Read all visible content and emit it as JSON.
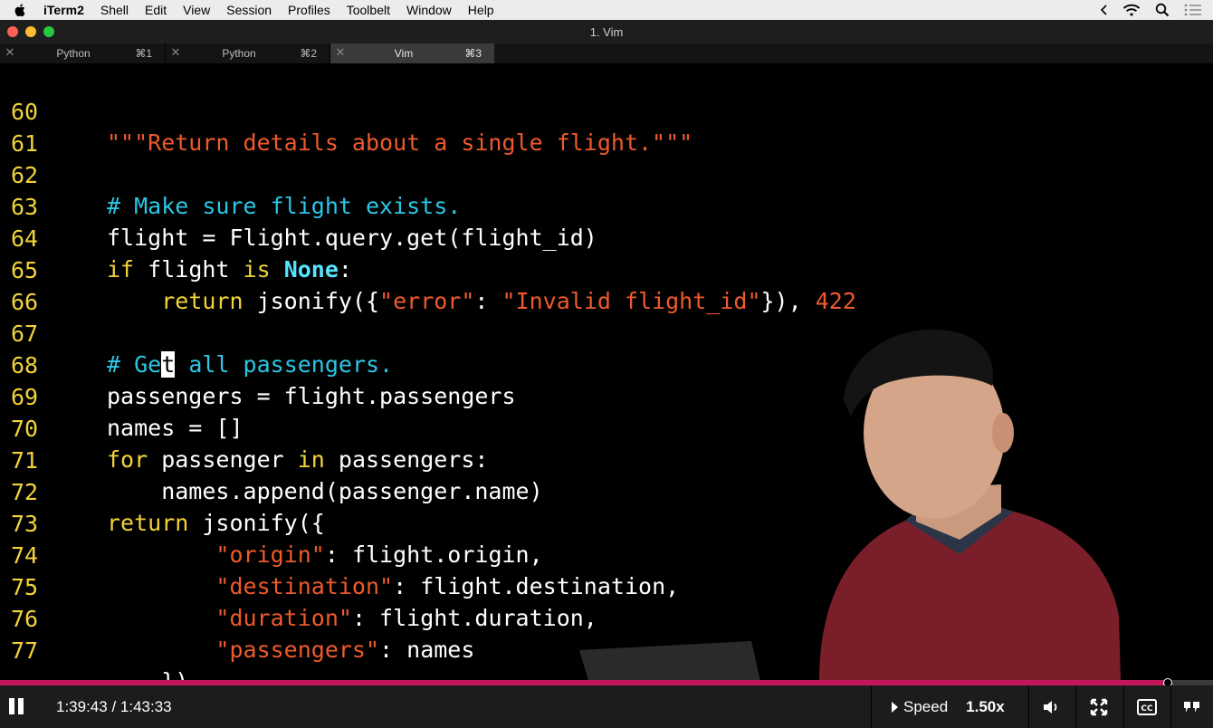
{
  "menubar": {
    "app": "iTerm2",
    "items": [
      "Shell",
      "Edit",
      "View",
      "Session",
      "Profiles",
      "Toolbelt",
      "Window",
      "Help"
    ]
  },
  "window": {
    "title": "1. Vim"
  },
  "tabs": [
    {
      "label": "Python",
      "shortcut": "⌘1"
    },
    {
      "label": "Python",
      "shortcut": "⌘2"
    },
    {
      "label": "Vim",
      "shortcut": "⌘3"
    }
  ],
  "code": {
    "line_numbers": [
      "60",
      "61",
      "62",
      "63",
      "64",
      "65",
      "66",
      "67",
      "68",
      "69",
      "70",
      "71",
      "72",
      "73",
      "74",
      "75",
      "76",
      "77"
    ],
    "l60": {
      "t1": "\"\"\"Return details about a single flight.\"\"\""
    },
    "l62": {
      "t1": "# Make sure flight exists."
    },
    "l63": {
      "t1": "flight = Flight.query.get(flight_id)"
    },
    "l64": {
      "t1": "if",
      "t2": " flight ",
      "t3": "is",
      "t4": " ",
      "t5": "None",
      "t6": ":"
    },
    "l65": {
      "t1": "    ",
      "t2": "return",
      "t3": " jsonify({",
      "t4": "\"error\"",
      "t5": ": ",
      "t6": "\"Invalid flight_id\"",
      "t7": "}), ",
      "t8": "422"
    },
    "l67": {
      "t1": "# Ge",
      "t2": "t",
      "t3": " all passengers."
    },
    "l68": {
      "t1": "passengers = flight.passengers"
    },
    "l69": {
      "t1": "names = ",
      "t2": "[]"
    },
    "l70": {
      "t1": "for",
      "t2": " passenger ",
      "t3": "in",
      "t4": " passengers:"
    },
    "l71": {
      "t1": "    names.append(passenger.name)"
    },
    "l72": {
      "t1": "return",
      "t2": " jsonify({"
    },
    "l73": {
      "t1": "        ",
      "t2": "\"origin\"",
      "t3": ": flight.origin,"
    },
    "l74": {
      "t1": "        ",
      "t2": "\"destination\"",
      "t3": ": flight.destination,"
    },
    "l75": {
      "t1": "        ",
      "t2": "\"duration\"",
      "t3": ": flight.duration,"
    },
    "l76": {
      "t1": "        ",
      "t2": "\"passengers\"",
      "t3": ": names"
    },
    "l77": {
      "t1": "    })"
    }
  },
  "colors": {
    "string": "#ee5a2c",
    "comment": "#2cc7e6",
    "keyword": "#f3d33a",
    "line_number": "#f3d33a",
    "progress": "#c2185b"
  },
  "player": {
    "time": "1:39:43 / 1:43:33",
    "progress_fraction": 0.963,
    "speed_label": "Speed",
    "speed_value": "1.50x",
    "icons": [
      "pause-icon",
      "volume-icon",
      "fullscreen-icon",
      "closed-captions-icon",
      "transcript-icon"
    ]
  }
}
